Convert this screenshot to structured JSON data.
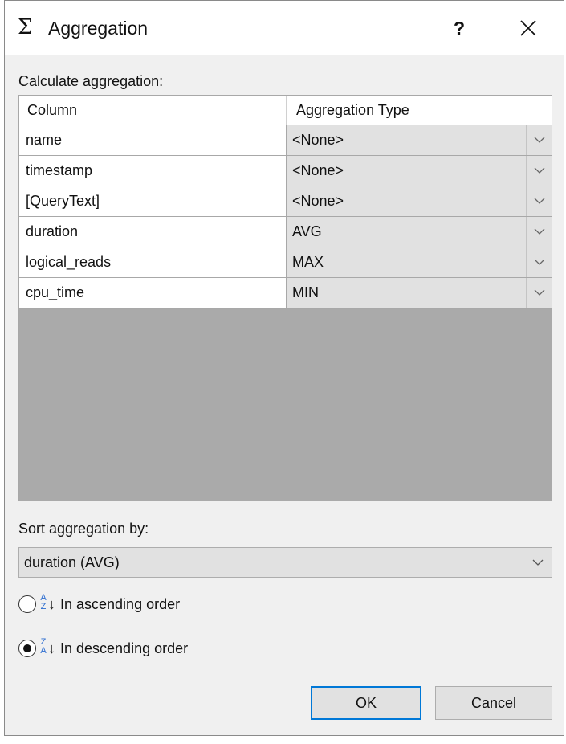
{
  "window": {
    "title_icon": "Σ",
    "title": "Aggregation",
    "help_label": "?",
    "close_icon": "close-icon"
  },
  "calc_label": "Calculate aggregation:",
  "grid": {
    "headers": [
      "Column",
      "Aggregation Type"
    ],
    "rows": [
      {
        "column": "name",
        "aggregation": "<None>"
      },
      {
        "column": "timestamp",
        "aggregation": "<None>"
      },
      {
        "column": "[QueryText]",
        "aggregation": "<None>"
      },
      {
        "column": "duration",
        "aggregation": "AVG"
      },
      {
        "column": "logical_reads",
        "aggregation": "MAX"
      },
      {
        "column": "cpu_time",
        "aggregation": "MIN"
      }
    ]
  },
  "sort": {
    "label": "Sort aggregation by:",
    "selected": "duration (AVG)",
    "options": [
      {
        "label": "In ascending order",
        "icon": "sort-ascending-icon",
        "icon_text": "A Z",
        "checked": false
      },
      {
        "label": "In descending order",
        "icon": "sort-descending-icon",
        "icon_text": "Z A",
        "checked": true
      }
    ]
  },
  "buttons": {
    "ok": "OK",
    "cancel": "Cancel"
  },
  "colors": {
    "dialog_bg": "#f0f0f0",
    "grid_empty_bg": "#aaaaaa",
    "dropdown_bg": "#e1e1e1",
    "accent_border": "#0078d7"
  }
}
